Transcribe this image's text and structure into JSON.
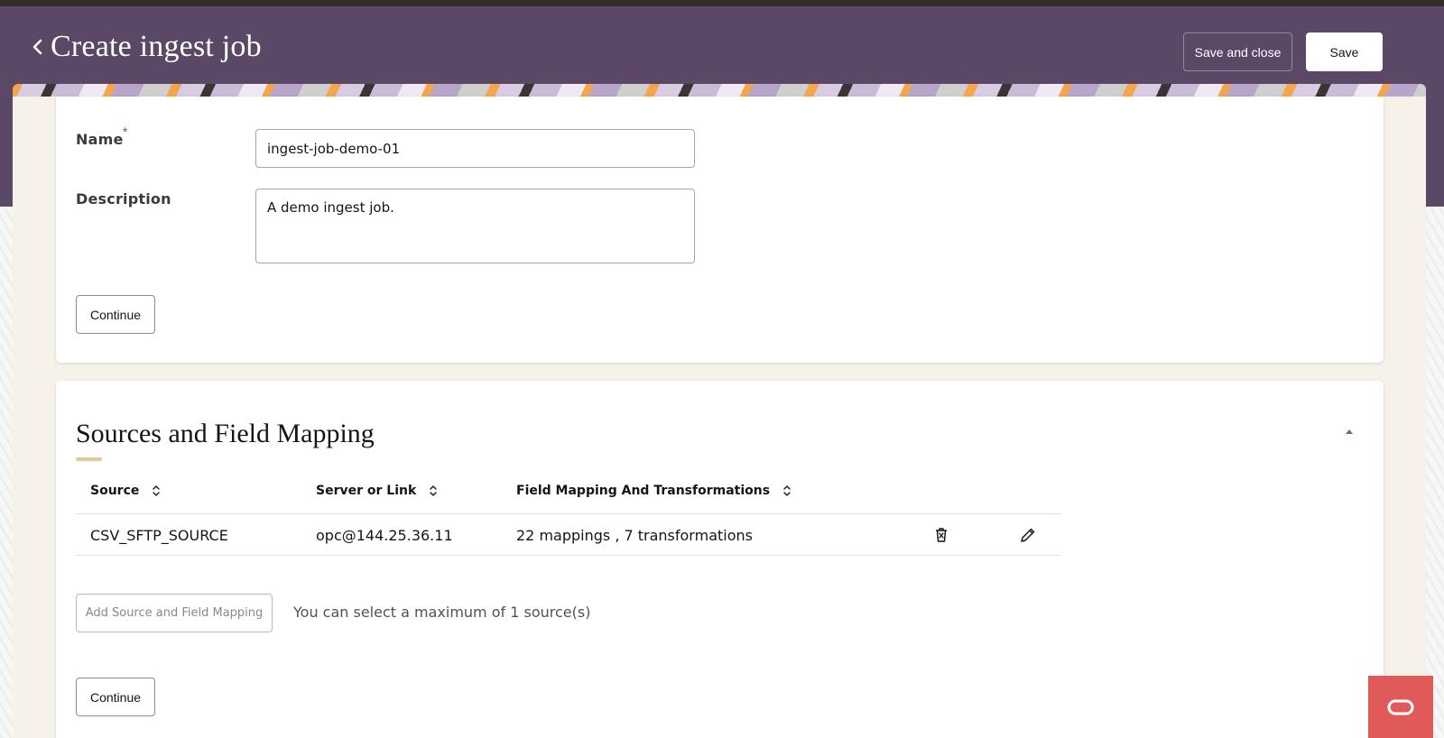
{
  "header": {
    "title": "Create ingest job",
    "save_and_close_label": "Save and close",
    "save_label": "Save",
    "back_icon": "chevron-left-icon"
  },
  "basic_info": {
    "name_label": "Name",
    "required_marker": "*",
    "name_value": "ingest-job-demo-01",
    "description_label": "Description",
    "description_value": "A demo ingest job.",
    "continue_label": "Continue"
  },
  "sources": {
    "title": "Sources and Field Mapping",
    "collapse_icon": "caret-up-icon",
    "columns": [
      "Source",
      "Server or Link",
      "Field Mapping And Transformations"
    ],
    "rows": [
      {
        "source": "CSV_SFTP_SOURCE",
        "server": "opc@144.25.36.11",
        "mapping": "22 mappings , 7 transformations",
        "delete_icon": "trash-icon",
        "edit_icon": "pencil-icon"
      }
    ],
    "add_label": "Add Source and Field Mapping",
    "hint": "You can select a maximum of 1 source(s)",
    "continue_label": "Continue"
  },
  "colors": {
    "header_bg": "#5a4866",
    "accent_underline": "#e9c69a",
    "help_button": "#e05a5a",
    "panel_bg": "#f6f2e9"
  },
  "help_button_icon": "chat-bubble-icon"
}
